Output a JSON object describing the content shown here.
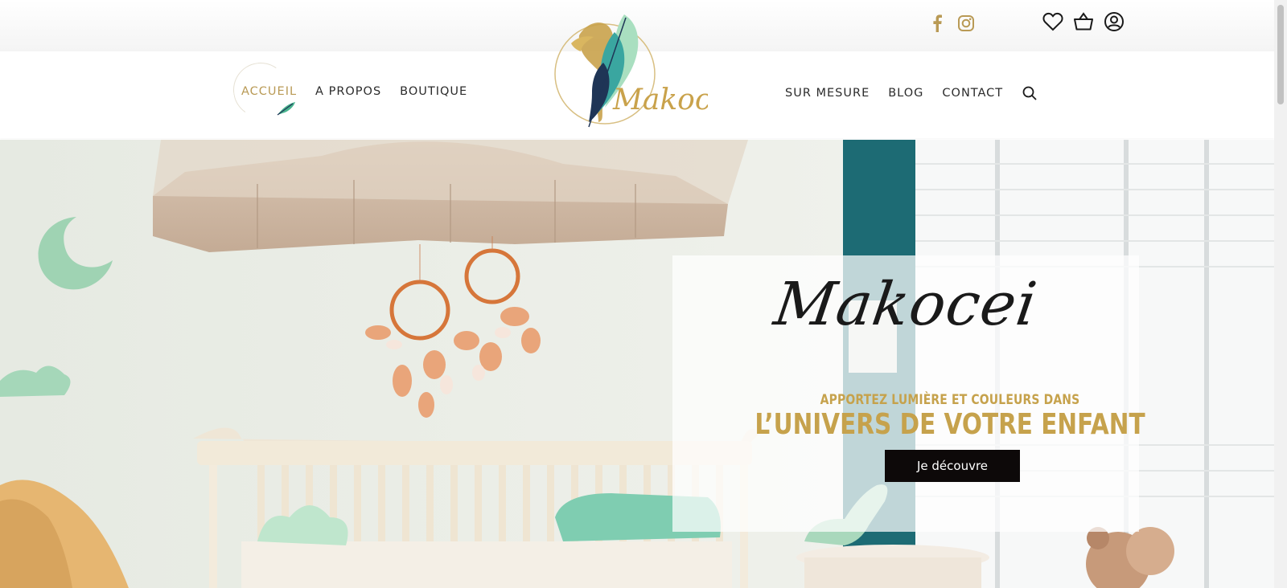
{
  "brand": {
    "name": "Makocei"
  },
  "social": [
    {
      "name": "facebook-icon"
    },
    {
      "name": "instagram-icon"
    }
  ],
  "user_icons": [
    {
      "name": "heart-icon"
    },
    {
      "name": "basket-icon"
    },
    {
      "name": "account-icon"
    }
  ],
  "nav": {
    "left": [
      "ACCUEIL",
      "A PROPOS",
      "BOUTIQUE"
    ],
    "right": [
      "SUR MESURE",
      "BLOG",
      "CONTACT"
    ],
    "active": "ACCUEIL"
  },
  "hero": {
    "script_title": "Makocei",
    "tagline_line1": "APPORTEZ LUMIÈRE ET COULEURS DANS",
    "tagline_line2": "L’UNIVERS DE VOTRE ENFANT",
    "cta_label": "Je découvre"
  },
  "colors": {
    "gold": "#c6a24c",
    "nav_active": "#b99a55",
    "teal": "#1d6b74",
    "button": "#0d0909"
  }
}
